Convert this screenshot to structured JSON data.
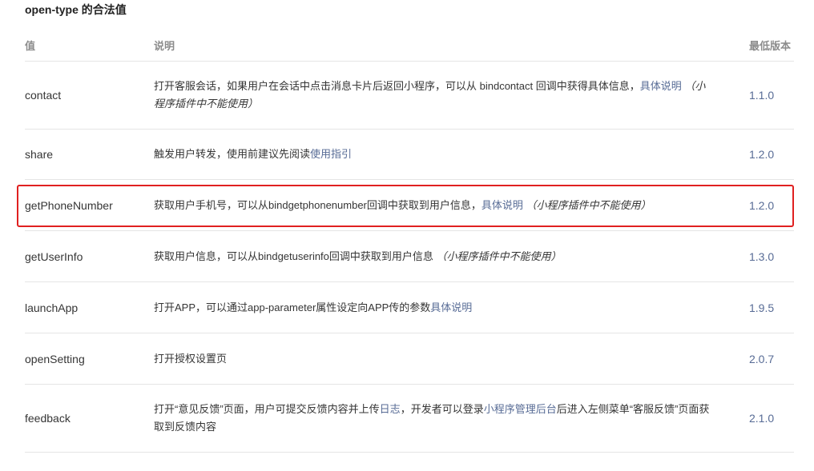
{
  "section_title": "open-type 的合法值",
  "columns": {
    "value": "值",
    "desc": "说明",
    "version": "最低版本"
  },
  "rows": [
    {
      "name": "contact",
      "desc_text": "打开客服会话，如果用户在会话中点击消息卡片后返回小程序，可以从 bindcontact 回调中获得具体信息，",
      "link1": "具体说明",
      "note": "（小程序插件中不能使用）",
      "version": "1.1.0"
    },
    {
      "name": "share",
      "desc_text": "触发用户转发，使用前建议先阅读",
      "link1": "使用指引",
      "version": "1.2.0"
    },
    {
      "name": "getPhoneNumber",
      "desc_text": "获取用户手机号，可以从bindgetphonenumber回调中获取到用户信息，",
      "link1": "具体说明",
      "note": "（小程序插件中不能使用）",
      "version": "1.2.0",
      "highlighted": true
    },
    {
      "name": "getUserInfo",
      "desc_text": "获取用户信息，可以从bindgetuserinfo回调中获取到用户信息 ",
      "note": "（小程序插件中不能使用）",
      "version": "1.3.0"
    },
    {
      "name": "launchApp",
      "desc_text": "打开APP，可以通过app-parameter属性设定向APP传的参数",
      "link1": "具体说明",
      "version": "1.9.5"
    },
    {
      "name": "openSetting",
      "desc_text": "打开授权设置页",
      "version": "2.0.7"
    },
    {
      "name": "feedback",
      "desc_pre": "打开“意见反馈”页面，用户可提交反馈内容并上传",
      "link1": "日志",
      "desc_mid": "，开发者可以登录",
      "link2": "小程序管理后台",
      "desc_post": "后进入左侧菜单“客服反馈”页面获取到反馈内容",
      "version": "2.1.0"
    }
  ],
  "colors": {
    "link": "#576b95",
    "highlight_border": "#e02020",
    "divider": "#e5e5e5"
  }
}
